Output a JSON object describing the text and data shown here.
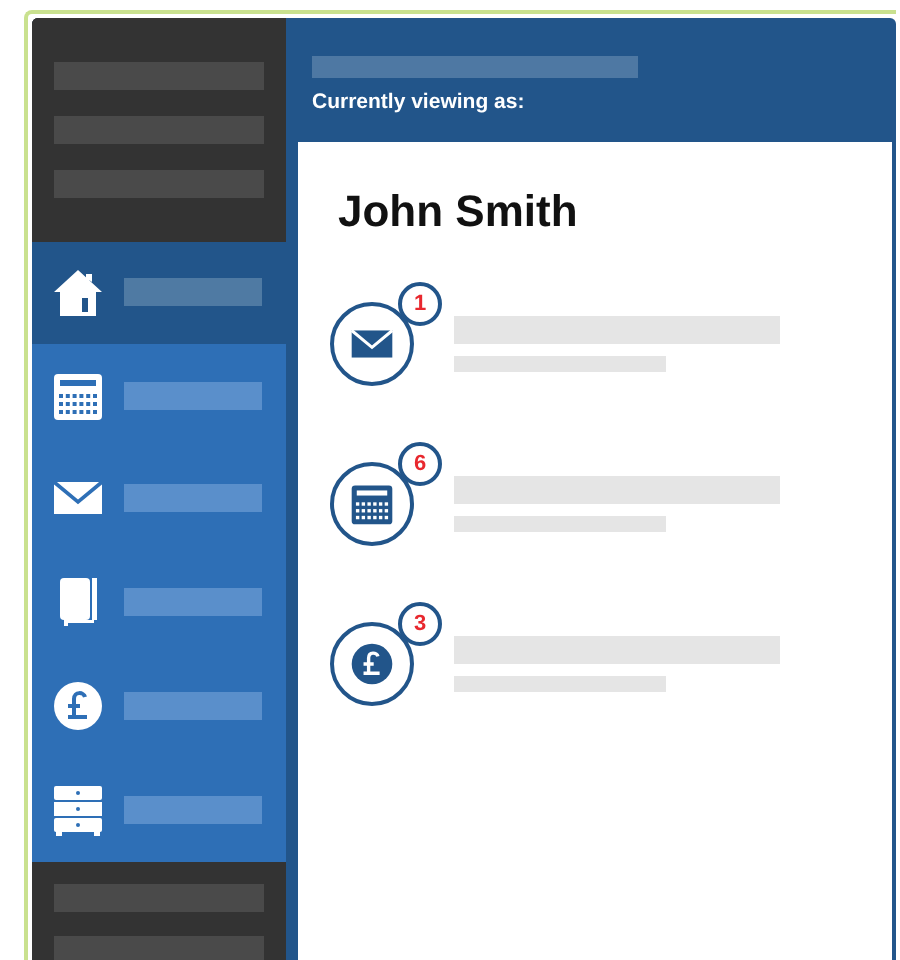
{
  "header": {
    "viewing_label": "Currently viewing as:"
  },
  "user": {
    "name": "John Smith"
  },
  "sidebar": {
    "items": [
      {
        "kind": "home",
        "selected": true
      },
      {
        "kind": "calendar",
        "selected": false
      },
      {
        "kind": "mail",
        "selected": false
      },
      {
        "kind": "book",
        "selected": false
      },
      {
        "kind": "pound",
        "selected": false
      },
      {
        "kind": "drawers",
        "selected": false
      }
    ]
  },
  "notifications": [
    {
      "kind": "mail",
      "count": "1"
    },
    {
      "kind": "calendar",
      "count": "6"
    },
    {
      "kind": "pound",
      "count": "3"
    }
  ]
}
